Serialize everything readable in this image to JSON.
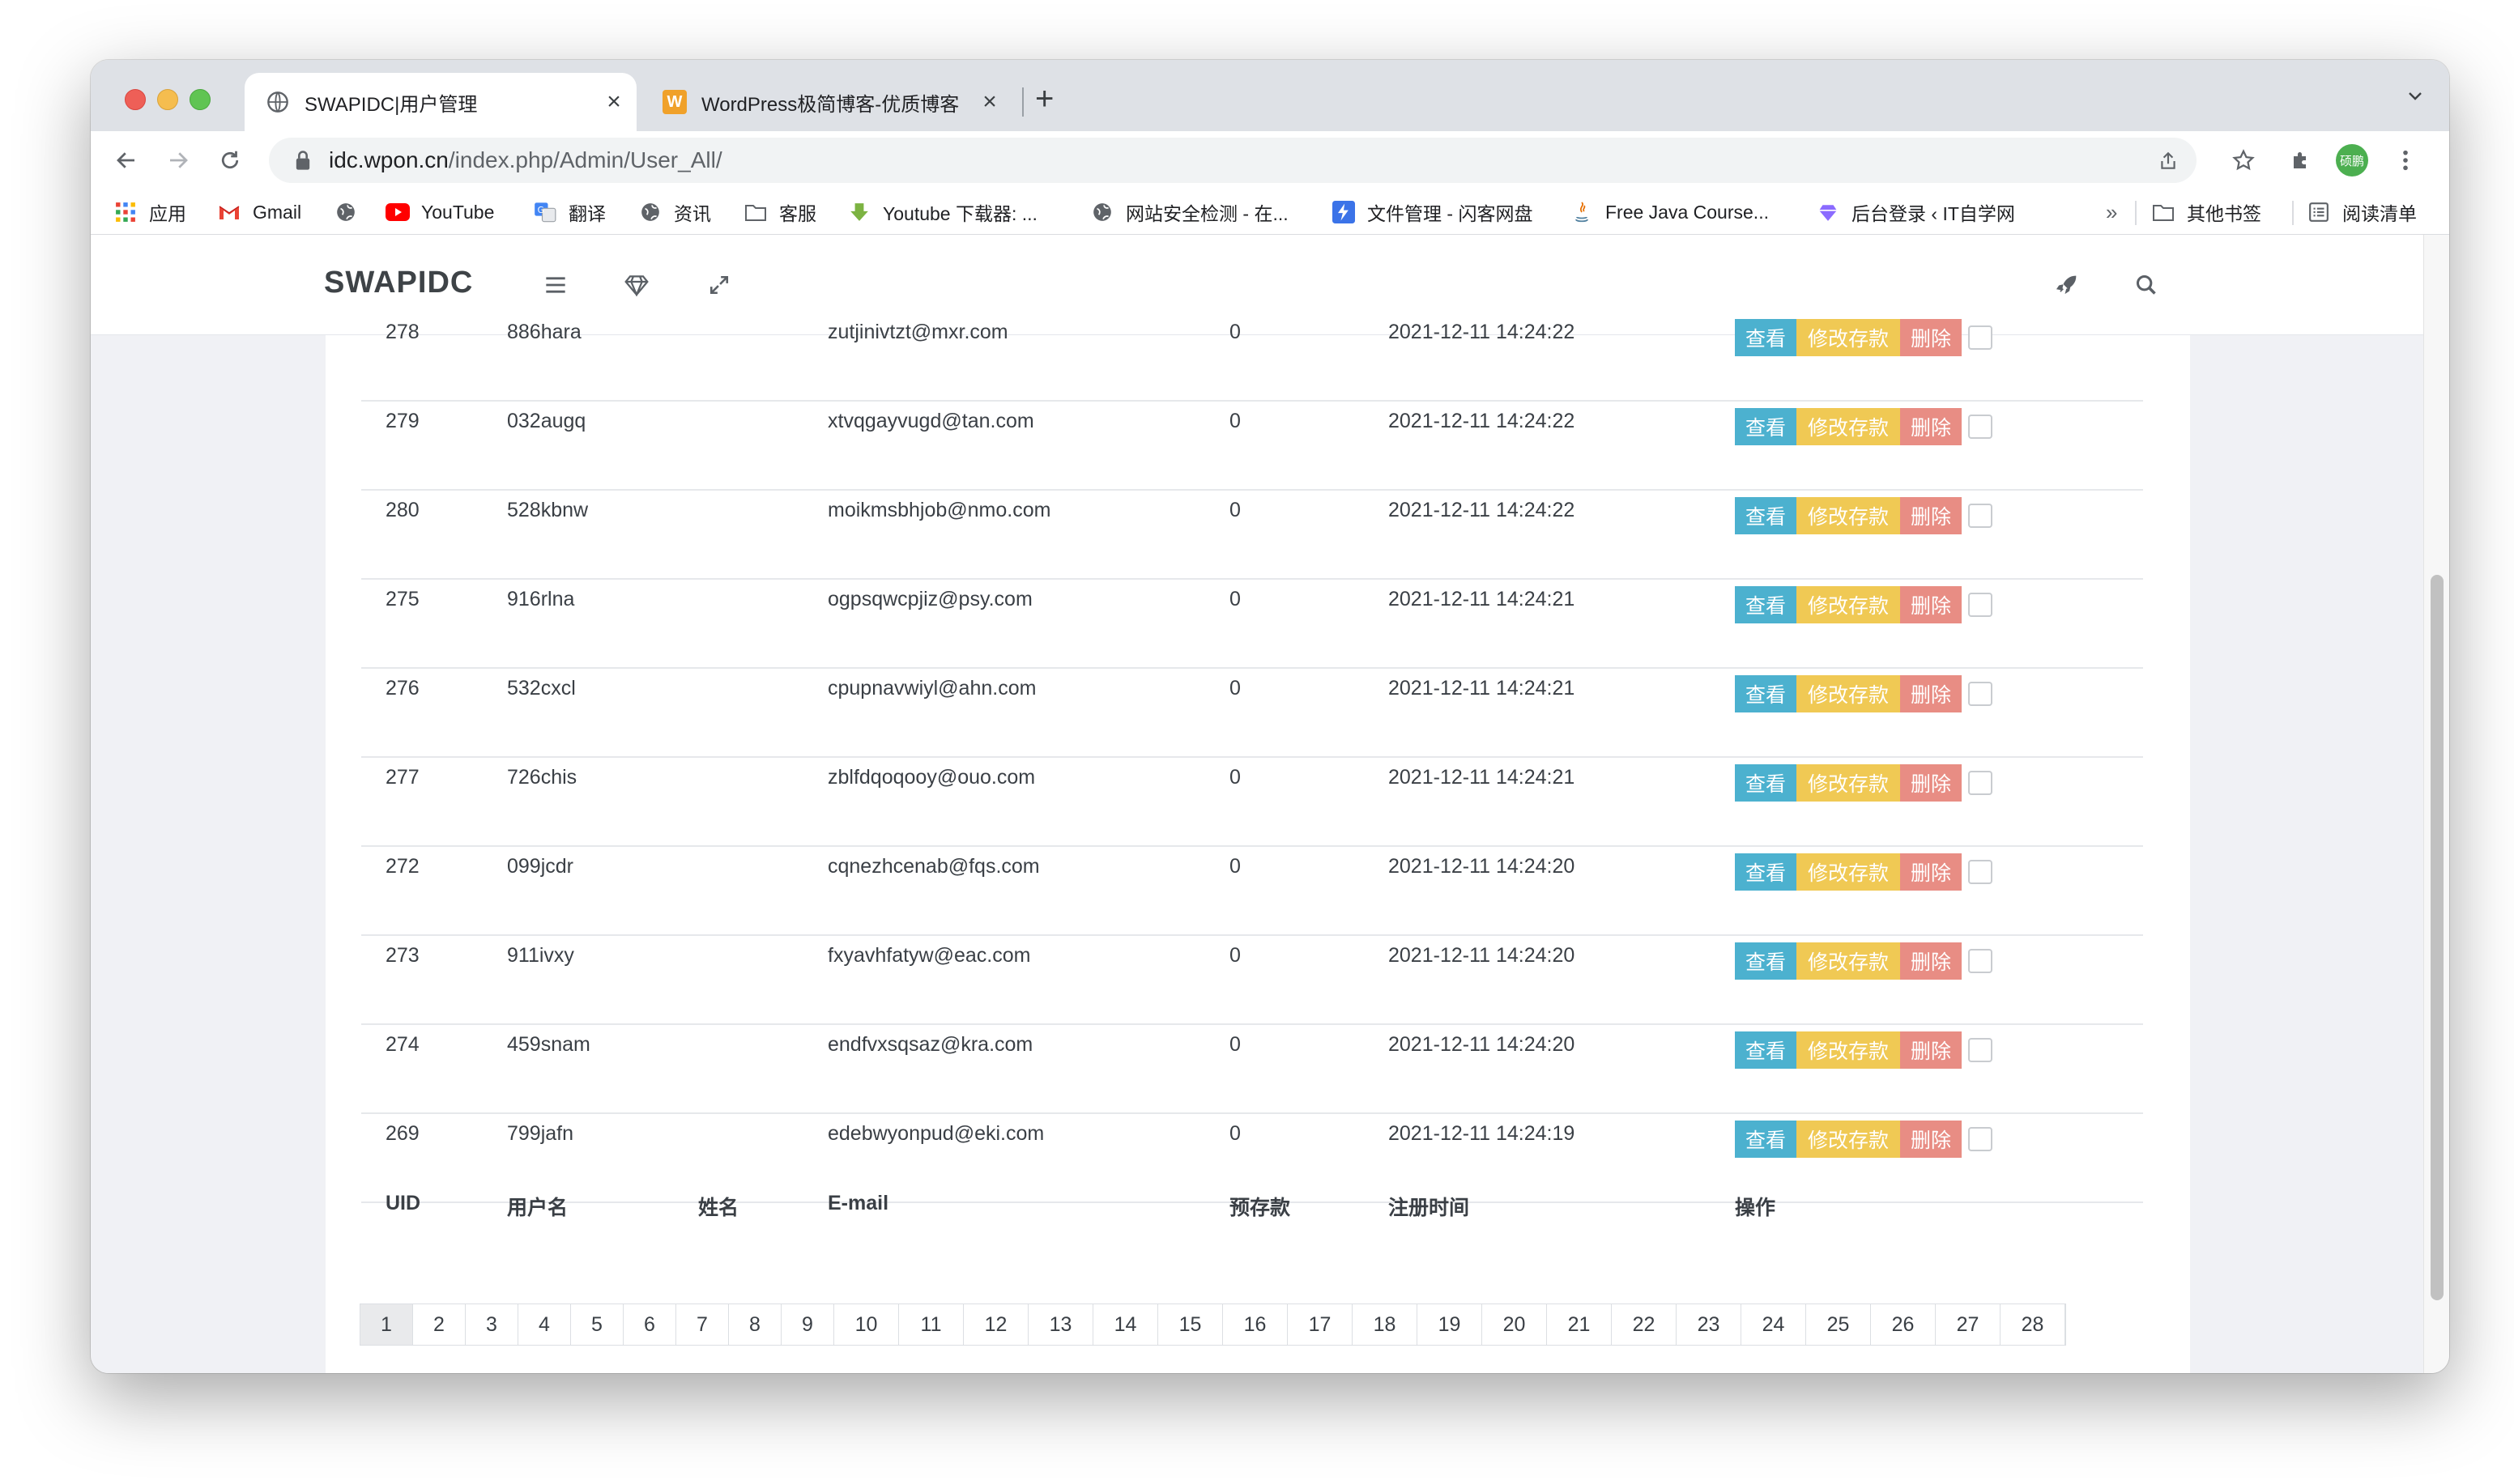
{
  "browser": {
    "tabs": [
      {
        "title": "SWAPIDC|用户管理",
        "active": true,
        "favicon": "globe-icon"
      },
      {
        "title": "WordPress极简博客-优质博客",
        "active": false,
        "favicon": "w-logo-icon",
        "favicon_text": "W"
      }
    ],
    "url_host": "idc.wpon.cn",
    "url_path": "/index.php/Admin/User_All/",
    "profile_label": "硕鹏",
    "bookmarks": [
      {
        "label": "应用",
        "icon": "apps-grid-icon"
      },
      {
        "label": "Gmail",
        "icon": "gmail-icon"
      },
      {
        "label": "",
        "icon": "globe-icon"
      },
      {
        "label": "YouTube",
        "icon": "youtube-icon"
      },
      {
        "label": "翻译",
        "icon": "translate-icon"
      },
      {
        "label": "资讯",
        "icon": "globe-icon"
      },
      {
        "label": "客服",
        "icon": "folder-icon"
      },
      {
        "label": "Youtube 下载器: ...",
        "icon": "download-icon"
      },
      {
        "label": "网站安全检测 - 在...",
        "icon": "globe-icon"
      },
      {
        "label": "文件管理 - 闪客网盘",
        "icon": "bolt-icon"
      },
      {
        "label": "Free Java Course...",
        "icon": "java-icon"
      },
      {
        "label": "后台登录 ‹ IT自学网",
        "icon": "heart-icon"
      }
    ],
    "bookmarks_overflow": "»",
    "other_bookmarks": "其他书签",
    "reading_list": "阅读清单"
  },
  "app": {
    "brand": "SWAPIDC"
  },
  "table": {
    "headers": {
      "uid": "UID",
      "username": "用户名",
      "name": "姓名",
      "email": "E-mail",
      "balance": "预存款",
      "regtime": "注册时间",
      "ops": "操作"
    },
    "action_labels": {
      "view": "查看",
      "edit": "修改存款",
      "delete": "删除"
    },
    "rows": [
      {
        "uid": "278",
        "username": "886hara",
        "name": "",
        "email": "zutjinivtzt@mxr.com",
        "balance": "0",
        "regtime": "2021-12-11 14:24:22"
      },
      {
        "uid": "279",
        "username": "032augq",
        "name": "",
        "email": "xtvqgayvugd@tan.com",
        "balance": "0",
        "regtime": "2021-12-11 14:24:22"
      },
      {
        "uid": "280",
        "username": "528kbnw",
        "name": "",
        "email": "moikmsbhjob@nmo.com",
        "balance": "0",
        "regtime": "2021-12-11 14:24:22"
      },
      {
        "uid": "275",
        "username": "916rlna",
        "name": "",
        "email": "ogpsqwcpjiz@psy.com",
        "balance": "0",
        "regtime": "2021-12-11 14:24:21"
      },
      {
        "uid": "276",
        "username": "532cxcl",
        "name": "",
        "email": "cpupnavwiyl@ahn.com",
        "balance": "0",
        "regtime": "2021-12-11 14:24:21"
      },
      {
        "uid": "277",
        "username": "726chis",
        "name": "",
        "email": "zblfdqoqooy@ouo.com",
        "balance": "0",
        "regtime": "2021-12-11 14:24:21"
      },
      {
        "uid": "272",
        "username": "099jcdr",
        "name": "",
        "email": "cqnezhcenab@fqs.com",
        "balance": "0",
        "regtime": "2021-12-11 14:24:20"
      },
      {
        "uid": "273",
        "username": "911ivxy",
        "name": "",
        "email": "fxyavhfatyw@eac.com",
        "balance": "0",
        "regtime": "2021-12-11 14:24:20"
      },
      {
        "uid": "274",
        "username": "459snam",
        "name": "",
        "email": "endfvxsqsaz@kra.com",
        "balance": "0",
        "regtime": "2021-12-11 14:24:20"
      },
      {
        "uid": "269",
        "username": "799jafn",
        "name": "",
        "email": "edebwyonpud@eki.com",
        "balance": "0",
        "regtime": "2021-12-11 14:24:19"
      }
    ]
  },
  "pagination": {
    "current": "1",
    "pages": [
      "1",
      "2",
      "3",
      "4",
      "5",
      "6",
      "7",
      "8",
      "9",
      "10",
      "11",
      "12",
      "13",
      "14",
      "15",
      "16",
      "17",
      "18",
      "19",
      "20",
      "21",
      "22",
      "23",
      "24",
      "25",
      "26",
      "27",
      "28"
    ]
  },
  "colors": {
    "view_button": "#4cb1cf",
    "edit_button": "#f0c954",
    "delete_button": "#e88d84",
    "page_background": "#f0f1f5"
  }
}
